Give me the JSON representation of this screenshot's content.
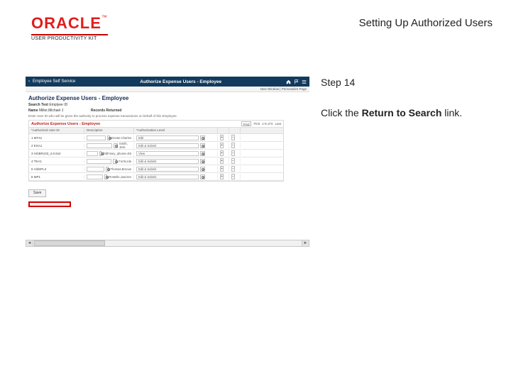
{
  "header": {
    "title": "Setting Up Authorized Users"
  },
  "logo": {
    "brand": "ORACLE",
    "tm": "™",
    "sub": "USER PRODUCTIVITY KIT"
  },
  "instruction": {
    "step": "Step 14",
    "prefix": "Click the ",
    "bold": "Return to Search",
    "suffix": " link."
  },
  "app": {
    "back": "‹",
    "left": "Employee Self Service",
    "center": "Authorize Expense Users - Employee",
    "subbar": "New Window | Personalize Page",
    "title": "Authorize Expense Users - Employee",
    "search_label": "Search Text",
    "search_val": "Emplyee ID",
    "name_lbl": "Name",
    "name_val": "Miller,Michael J",
    "records_lbl": "Records Returned",
    "fine": "Enter User ID who will be given the authority to process expense transactions on behalf of this Employee.",
    "table": {
      "title": "Authorize Expense Users - Employee",
      "nav_prev": "First",
      "nav_range": "1-5 of 5",
      "nav_next": "Last",
      "find": "Find",
      "cols": [
        "*Authorized User ID",
        "Description",
        "*Authorization Level"
      ],
      "rows": [
        {
          "id": "1  MT41",
          "user": "Q",
          "desc": "Dexter,Charles",
          "level": "Edit"
        },
        {
          "id": "2  EXA1",
          "user": "Q",
          "desc": "Smith, Jess",
          "level": "Edit & Submit"
        },
        {
          "id": "3  HGBR103_4.0.6v2",
          "user": "Q",
          "desc": "[M]Fosey_qhuser=E6",
          "level": "View"
        },
        {
          "id": "4  TEA1",
          "user": "Q",
          "desc": "Fortin,Ida",
          "level": "Edit & Submit"
        },
        {
          "id": "5  VidSPL3",
          "user": "Q",
          "desc": "Thomas,Broous",
          "level": "Edit & Submit"
        },
        {
          "id": "6  MP1",
          "user": "Q",
          "desc": "Rostelle,Joacism",
          "level": "Edit & Submit"
        }
      ]
    },
    "save": "Save"
  }
}
